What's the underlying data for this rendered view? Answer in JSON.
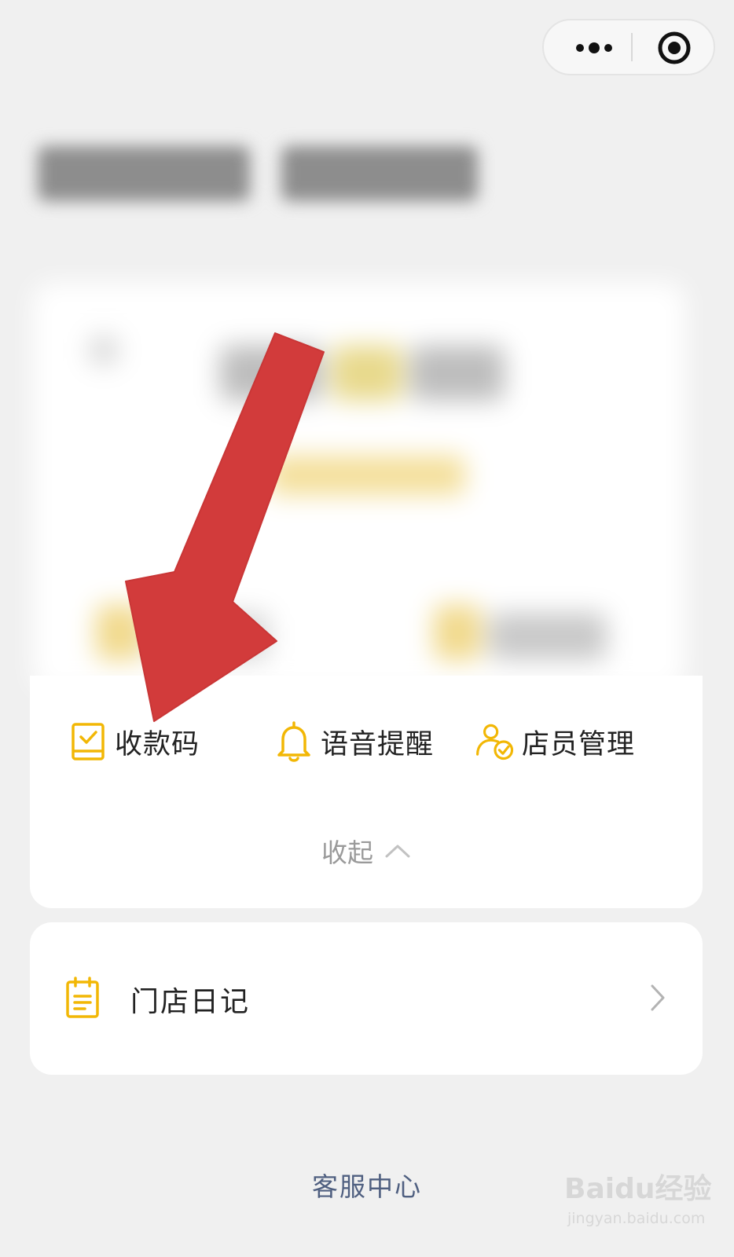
{
  "capsule": {
    "more_icon": "more-dots-icon",
    "close_icon": "close-circle-icon"
  },
  "functions": {
    "items": [
      {
        "label": "收款码",
        "icon": "payment-code-icon"
      },
      {
        "label": "语音提醒",
        "icon": "bell-icon"
      },
      {
        "label": "店员管理",
        "icon": "staff-check-icon"
      }
    ],
    "collapse_label": "收起",
    "collapse_icon": "chevron-up-icon"
  },
  "diary": {
    "label": "门店日记",
    "icon": "notepad-icon",
    "chevron_icon": "chevron-right-icon"
  },
  "footer": {
    "service_label": "客服中心"
  },
  "watermark": {
    "brand": "Baidu经验",
    "url": "jingyan.baidu.com"
  },
  "colors": {
    "accent_yellow": "#f2b705",
    "annotation_red": "#d23b3b",
    "link_blue": "#4f5f80",
    "page_background": "#f0f0f0"
  }
}
